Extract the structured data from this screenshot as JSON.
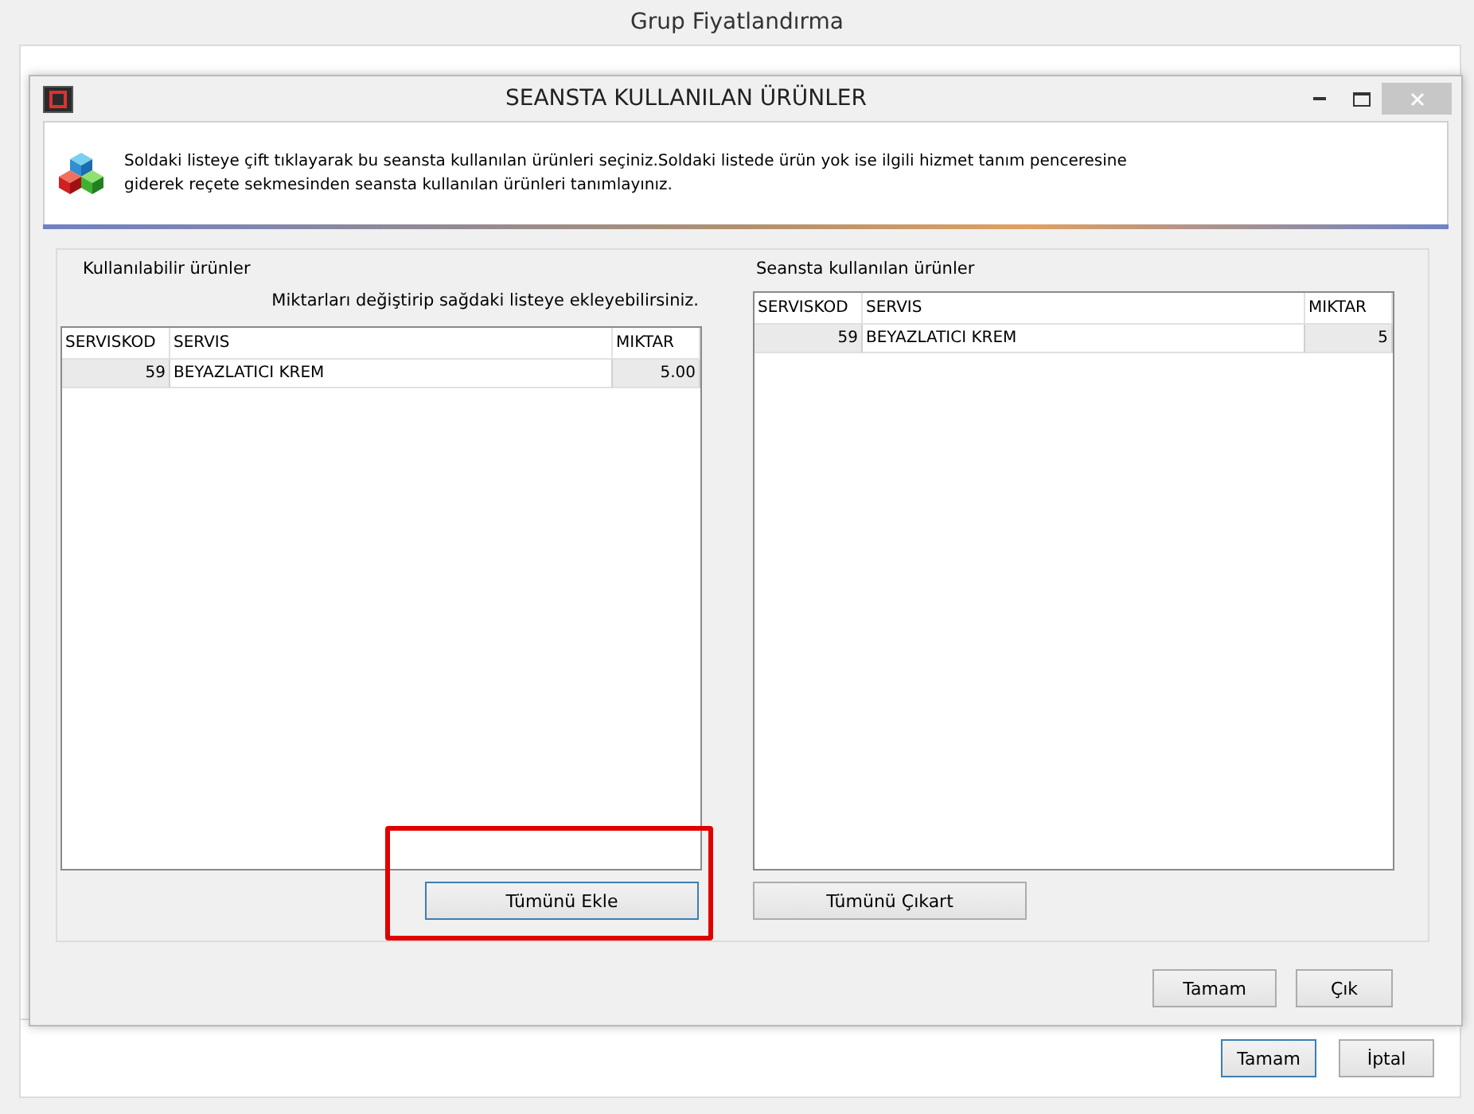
{
  "window": {
    "title": "Grup Fiyatlandırma",
    "buttons": [
      {
        "label": "Tamam",
        "focused": true
      },
      {
        "label": "İptal",
        "focused": false
      }
    ]
  },
  "dialog": {
    "title": "SEANSTA KULLANILAN ÜRÜNLER",
    "info_lines": [
      "Soldaki listeye çift tıklayarak bu seansta kullanılan ürünleri seçiniz.Soldaki listede ürün yok ise ilgili hizmet tanım penceresine",
      "giderek reçete sekmesinden seansta kullanılan ürünleri tanımlayınız."
    ],
    "panels": [
      {
        "title": "Kullanılabilir ürünler",
        "hint": "Miktarları değiştirip sağdaki listeye ekleyebilirsiniz.",
        "columns": [
          "SERVISKOD",
          "SERVIS",
          "MIKTAR"
        ],
        "rows": [
          {
            "cells": [
              "59",
              "BEYAZLATICI KREM",
              "5.00"
            ]
          }
        ],
        "button": {
          "label": "Tümünü Ekle",
          "focused": true
        }
      },
      {
        "title": "Seansta kullanılan ürünler",
        "columns": [
          "SERVISKOD",
          "SERVIS",
          "MIKTAR"
        ],
        "rows": [
          {
            "cells": [
              "59",
              "BEYAZLATICI KREM",
              "5"
            ]
          }
        ],
        "button": {
          "label": "Tümünü Çıkart",
          "focused": false
        }
      }
    ],
    "buttons": [
      {
        "label": "Tamam",
        "focused": false
      },
      {
        "label": "Çık",
        "focused": false
      }
    ]
  }
}
